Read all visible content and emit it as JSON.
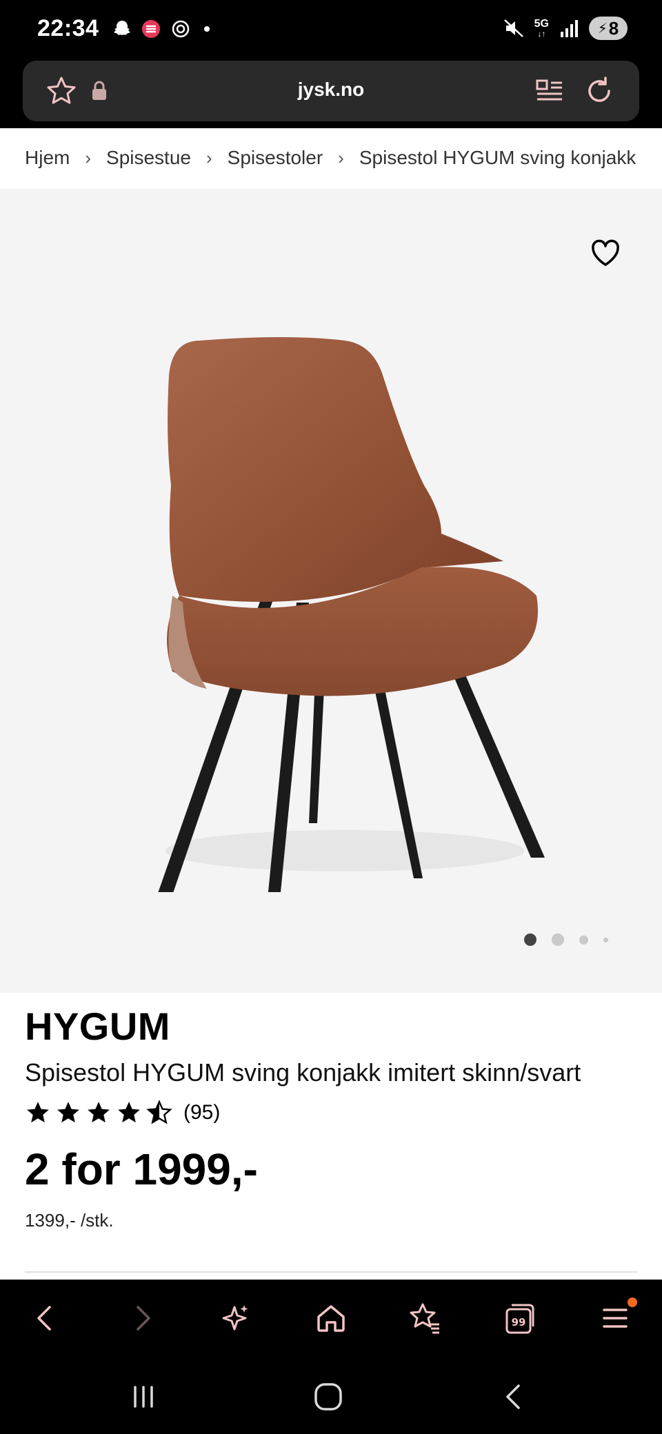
{
  "status_bar": {
    "time": "22:34",
    "network": "5G",
    "battery": "8",
    "icons": [
      "snapchat-icon",
      "app-icon",
      "openai-icon",
      "dot-icon",
      "mute-icon",
      "network-icon",
      "signal-icon",
      "battery-icon"
    ]
  },
  "browser": {
    "url": "jysk.no",
    "icons": [
      "star-icon",
      "lock-icon",
      "reader-icon",
      "reload-icon"
    ]
  },
  "breadcrumb": {
    "items": [
      "Hjem",
      "Spisestue",
      "Spisestoler",
      "Spisestol HYGUM sving konjakk"
    ],
    "separator": "›"
  },
  "gallery": {
    "image": "Spisestol HYGUM sving konjakk imitert skinn/svart",
    "current_slide": 1,
    "slide_count": 4
  },
  "product": {
    "brand": "HYGUM",
    "name": "Spisestol HYGUM sving konjakk imitert skinn/svart",
    "rating": 4.5,
    "rating_max": 5,
    "review_count": "(95)",
    "price": "2 for 1999,-",
    "unit_price": "1399,- /stk."
  },
  "toolbar": {
    "items": [
      "back-icon",
      "forward-icon",
      "sparkle-icon",
      "home-icon",
      "bookmarks-icon",
      "tabs-icon",
      "menu-icon"
    ],
    "tab_count": "99"
  },
  "navbar": {
    "items": [
      "recents-icon",
      "home-icon",
      "back-icon"
    ]
  },
  "colors": {
    "accent_icon": "#f2c4c4",
    "notification": "#f26a1b",
    "chair": "#9b5a3a"
  }
}
